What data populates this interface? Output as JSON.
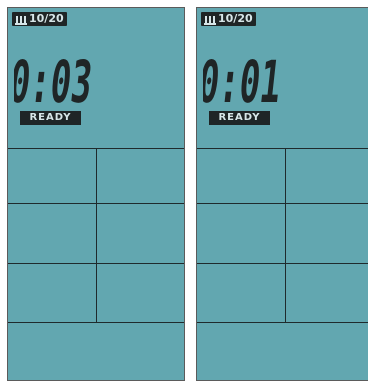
{
  "panels": [
    {
      "battery_label": "10/20",
      "timer_text": "0:03",
      "status_label": "READY"
    },
    {
      "battery_label": "10/20",
      "timer_text": "0:01",
      "status_label": "READY"
    }
  ],
  "colors": {
    "screen_bg": "#62a7b0",
    "lcd_dark": "#1f2526",
    "badge_text": "#d7e6e8",
    "grid_line": "#1f2a2c"
  },
  "icons": {
    "battery": "battery-bars-icon"
  }
}
